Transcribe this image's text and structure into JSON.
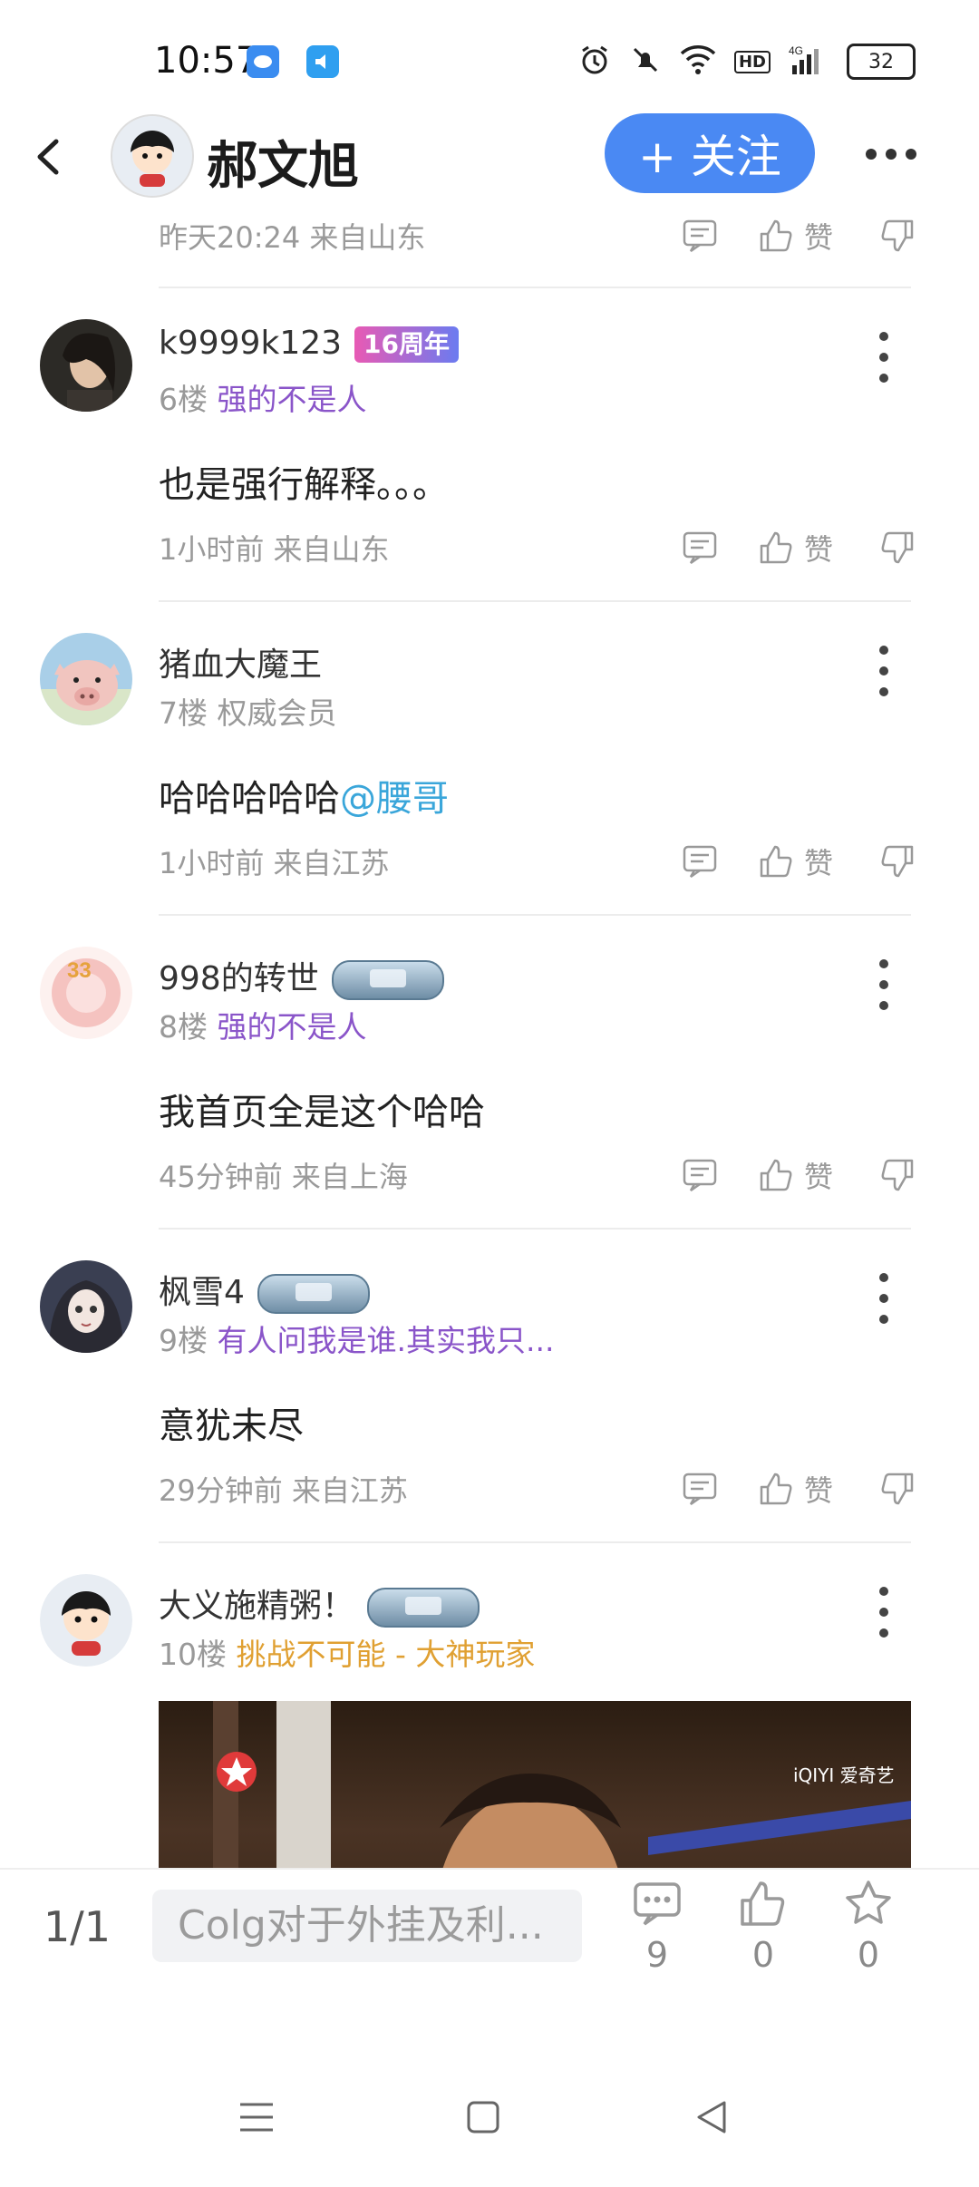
{
  "status_bar": {
    "time": "10:57",
    "battery": "32",
    "icons": [
      "app-icon-1",
      "app-icon-2",
      "alarm-icon",
      "mute-icon",
      "wifi-icon",
      "hd-icon",
      "signal-4g-icon",
      "battery-icon"
    ]
  },
  "header": {
    "title": "郝文旭",
    "follow_label": "+ 关注"
  },
  "top_meta": {
    "time_location": "昨天20:24 来自山东",
    "like_label": "赞"
  },
  "posts": [
    {
      "username": "k9999k123",
      "badge": "16周年",
      "floor": "6楼",
      "tag": "强的不是人",
      "content": "也是强行解释。。。",
      "meta": "1小时前 来自山东",
      "like_label": "赞"
    },
    {
      "username": "猪血大魔王",
      "floor": "7楼",
      "tag": "权威会员",
      "content": "哈哈哈哈哈",
      "mention": "@腰哥",
      "meta": "1小时前 来自江苏",
      "like_label": "赞"
    },
    {
      "username": "998的转世",
      "floor": "8楼",
      "tag": "强的不是人",
      "content": "我首页全是这个哈哈",
      "meta": "45分钟前 来自上海",
      "like_label": "赞"
    },
    {
      "username": "枫雪4",
      "floor": "9楼",
      "tag": "有人问我是谁.其实我只...",
      "content": "意犹未尽",
      "meta": "29分钟前 来自江苏",
      "like_label": "赞"
    },
    {
      "username": "大义施精粥！",
      "floor": "10楼",
      "tag": "挑战不可能 - 大神玩家",
      "media_watermark": "iQIYI 爱奇艺"
    }
  ],
  "bottom_bar": {
    "page_indicator": "1/1",
    "input_placeholder": "Colg对于外挂及利...",
    "comment_count": "9",
    "like_count": "0",
    "star_count": "0"
  }
}
